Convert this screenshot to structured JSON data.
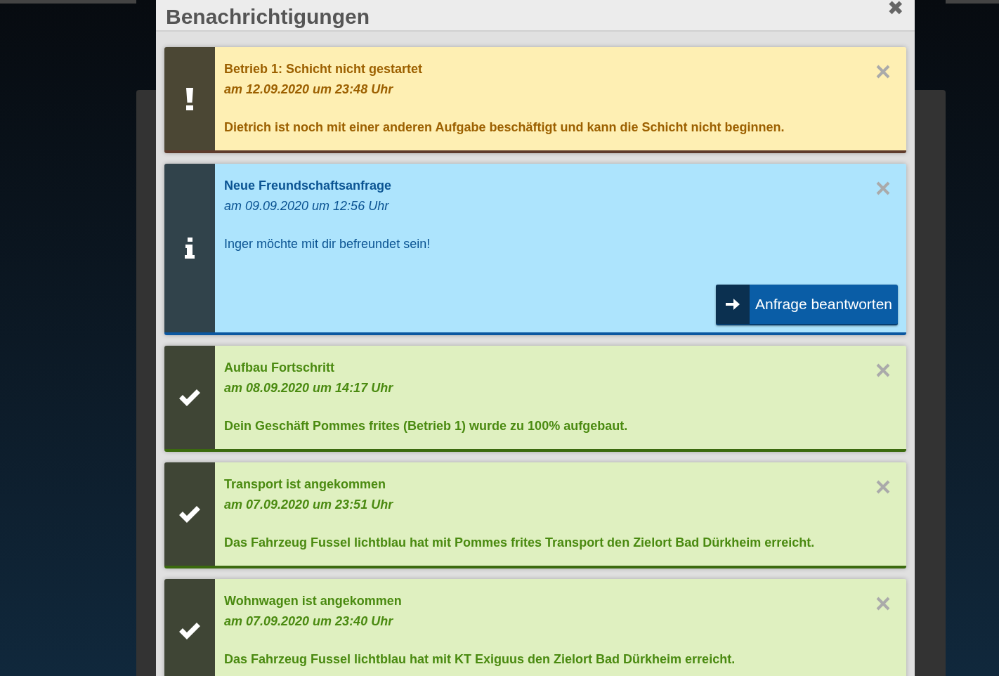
{
  "dialog": {
    "title": "Benachrichtigungen",
    "close": "✖"
  },
  "notifications": [
    {
      "kind": "warning",
      "title": "Betrieb 1: Schicht nicht gestartet",
      "date": "am 12.09.2020 um 23:48 Uhr",
      "message": "Dietrich ist noch mit einer anderen Aufgabe beschäftigt und kann die Schicht nicht beginnen."
    },
    {
      "kind": "info",
      "title": "Neue Freundschaftsanfrage",
      "date": "am 09.09.2020 um 12:56 Uhr",
      "message": "Inger möchte mit dir befreundet sein!",
      "action": "Anfrage beantworten"
    },
    {
      "kind": "success",
      "title": "Aufbau Fortschritt",
      "date": "am 08.09.2020 um 14:17 Uhr",
      "message": "Dein Geschäft Pommes frites (Betrieb 1) wurde zu 100% aufgebaut."
    },
    {
      "kind": "success",
      "title": "Transport ist angekommen",
      "date": "am 07.09.2020 um 23:51 Uhr",
      "message": "Das Fahrzeug Fussel lichtblau hat mit Pommes frites Transport den Zielort Bad Dürkheim erreicht."
    },
    {
      "kind": "success",
      "title": "Wohnwagen ist angekommen",
      "date": "am 07.09.2020 um 23:40 Uhr",
      "message": "Das Fahrzeug Fussel lichtblau hat mit KT Exiguus den Zielort Bad Dürkheim erreicht."
    }
  ]
}
